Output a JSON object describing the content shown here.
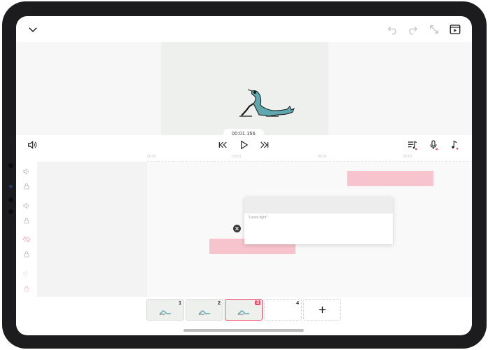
{
  "player": {
    "timecode": "00:01.156"
  },
  "ruler": {
    "labels": [
      "00:00",
      "00:01",
      "00:02",
      "00:03"
    ]
  },
  "popup": {
    "text": "\"Loose fight\""
  },
  "scenes": [
    {
      "number": "1",
      "selected": false,
      "empty": false
    },
    {
      "number": "2",
      "selected": false,
      "empty": false
    },
    {
      "number": "3",
      "selected": true,
      "empty": false
    },
    {
      "number": "4",
      "selected": false,
      "empty": true
    }
  ],
  "colors": {
    "accent": "#ee4d6a",
    "waveform": "#f7c3cd",
    "bezel": "#1c1c1e"
  },
  "icons": [
    "chevron-down-icon",
    "undo-icon",
    "redo-icon",
    "resize-icon",
    "film-icon",
    "volume-icon",
    "skip-back-icon",
    "play-icon",
    "skip-forward-icon",
    "music-list-icon",
    "mic-icon",
    "music-note-icon",
    "lock-icon",
    "eye-off-icon",
    "close-icon",
    "plus-icon"
  ]
}
